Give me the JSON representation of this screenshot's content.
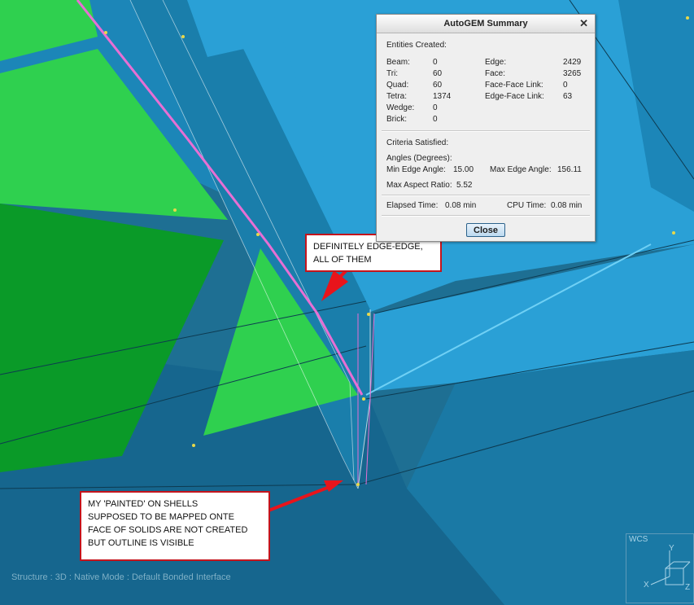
{
  "dialog": {
    "title": "AutoGEM Summary",
    "entities_header": "Entities Created:",
    "left_entities": [
      {
        "label": "Beam:",
        "value": "0"
      },
      {
        "label": "Tri:",
        "value": "60"
      },
      {
        "label": "Quad:",
        "value": "60"
      },
      {
        "label": "Tetra:",
        "value": "1374"
      },
      {
        "label": "Wedge:",
        "value": "0"
      },
      {
        "label": "Brick:",
        "value": "0"
      }
    ],
    "right_entities": [
      {
        "label": "Edge:",
        "value": "2429"
      },
      {
        "label": "Face:",
        "value": "3265"
      },
      {
        "label": "Face-Face Link:",
        "value": "0"
      },
      {
        "label": "Edge-Face Link:",
        "value": "63"
      }
    ],
    "criteria_header": "Criteria Satisfied:",
    "angles_header": "Angles (Degrees):",
    "min_edge_angle": {
      "label": "Min Edge Angle:",
      "value": "15.00"
    },
    "max_edge_angle": {
      "label": "Max Edge Angle:",
      "value": "156.11"
    },
    "max_aspect_ratio": {
      "label": "Max Aspect Ratio:",
      "value": "5.52"
    },
    "elapsed_time": {
      "label": "Elapsed Time:",
      "value": "0.08 min"
    },
    "cpu_time": {
      "label": "CPU Time:",
      "value": "0.08 min"
    },
    "close_label": "Close",
    "close_glyph": "✕"
  },
  "callouts": {
    "edge": [
      "DEFINITELY EDGE-EDGE,",
      "ALL OF THEM"
    ],
    "shells": [
      "MY 'PAINTED' ON SHELLS",
      "SUPPOSED TO BE MAPPED ONTE",
      "FACE OF SOLIDS ARE NOT CREATED",
      "BUT OUTLINE IS VISIBLE"
    ]
  },
  "status_text": "Structure : 3D : Native Mode : Default Bonded Interface",
  "wcs": {
    "label": "WCS",
    "axes": [
      "Y",
      "X",
      "Z"
    ]
  },
  "colors": {
    "background": "#1e6f93",
    "light_blue": "#2aa0d6",
    "mid_blue": "#1c86b8",
    "dark_blue": "#16668e",
    "shell_green": "#2fd04f",
    "dark_green": "#0a9a28",
    "pink_edge": "#e76fd4",
    "callout_border": "#c4141c",
    "arrow_red": "#e8141b"
  }
}
